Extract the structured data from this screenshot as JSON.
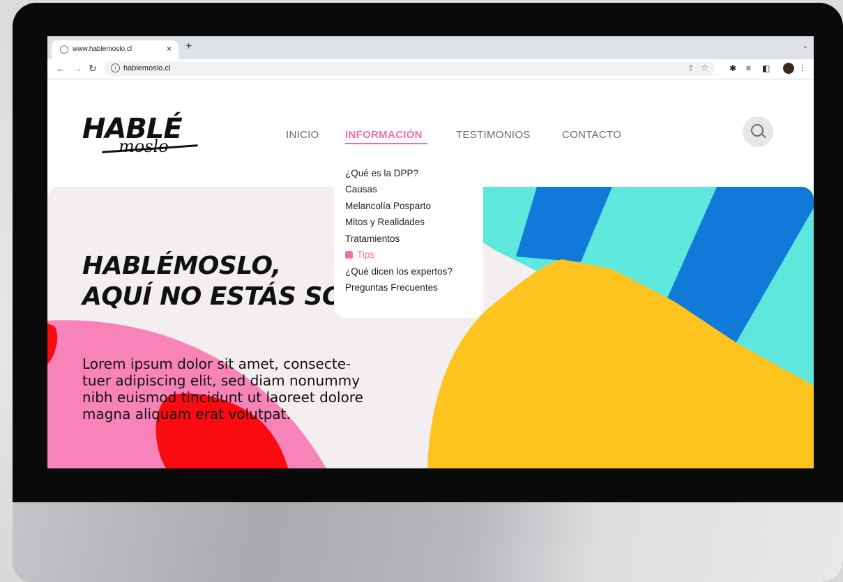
{
  "browser": {
    "tab_title": "www.hablemoslo.cl",
    "close_glyph": "×",
    "new_tab_glyph": "+",
    "url": "hablemoslo.cl",
    "icons": [
      "back-arrow-icon",
      "forward-arrow-icon",
      "reload-icon",
      "info-icon",
      "share-icon",
      "star-icon",
      "extensions-icon",
      "reading-list-icon",
      "side-panel-icon",
      "profile-avatar",
      "more-icon"
    ]
  },
  "site": {
    "logo_main": "HABLÉ",
    "logo_sub": "moslo",
    "nav": [
      {
        "label": "INICIO"
      },
      {
        "label": "INFORMACIÓN",
        "active": true
      },
      {
        "label": "TESTIMONIOS"
      },
      {
        "label": "CONTACTO"
      }
    ],
    "dropdown": [
      "¿Qué es la DPP?",
      "Causas",
      "Melancolía Posparto",
      "Mitos y Realidades",
      "Tratamientos",
      "Tips",
      "¿Qué dicen los expertos?",
      "Preguntas Frecuentes"
    ],
    "dropdown_active_index": 5,
    "hero_title_line1": "HABLÉMOSLO,",
    "hero_title_line2": "AQUÍ NO ESTÁS SO",
    "hero_text": "Lorem ipsum dolor sit amet, consecte-\ntuer adipiscing elit, sed diam nonummy\nnibh euismod tincidunt ut laoreet dolore\nmagna aliquam erat volutpat."
  },
  "colors": {
    "accent_pink": "#ef6fae",
    "hero_bg": "#f3eef0",
    "pink_shape": "#f783b8",
    "red_shape": "#f90b10",
    "yellow_shape": "#fdc41f",
    "teal_stripe": "#5de7dd",
    "blue_stripe": "#117ad9"
  }
}
